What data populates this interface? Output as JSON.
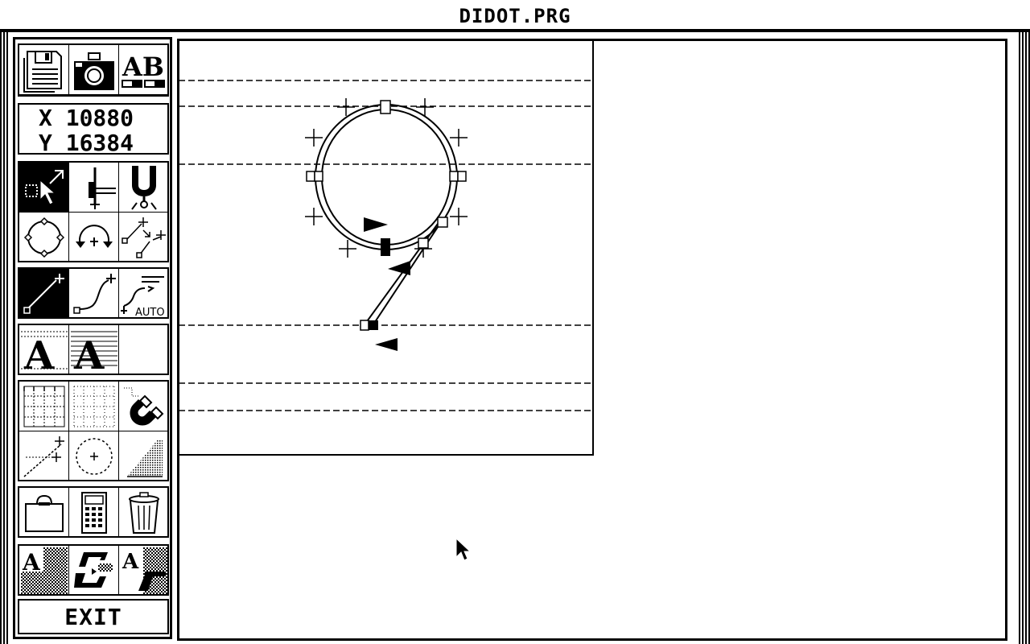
{
  "window": {
    "title": "DIDOT.PRG"
  },
  "coordinates": {
    "x_label": "X",
    "x_value": "10880",
    "y_label": "Y",
    "y_value": "16384"
  },
  "toolbar": {
    "file_tools": [
      "floppy-disk-icon",
      "camera-icon",
      "ab-font-icon"
    ],
    "select_tools": [
      "select-pointer-icon",
      "vertical-metrics-icon",
      "tuning-fork-icon"
    ],
    "transform_tools": [
      "circle-nodes-icon",
      "rotate-icon",
      "move-points-icon"
    ],
    "draw_tools": [
      "line-tool-icon",
      "curve-tool-icon",
      "auto-trace-icon"
    ],
    "auto_label": "AUTO",
    "glyph_tools": [
      "outline-a-icon",
      "hatched-a-icon",
      "empty-slot"
    ],
    "grid_tools": [
      "grid-icon",
      "dotted-grid-icon",
      "magnet-icon",
      "guide-line-icon",
      "circle-guide-icon",
      "dither-icon"
    ],
    "misc_tools": [
      "clipboard-icon",
      "calculator-icon",
      "trash-can-icon"
    ],
    "render_tools": [
      "shaded-a-icon",
      "chain-link-icon",
      "shadow-a-icon"
    ],
    "exit_label": "EXIT"
  },
  "glyph": {
    "name": "9",
    "point_type_legend": []
  }
}
